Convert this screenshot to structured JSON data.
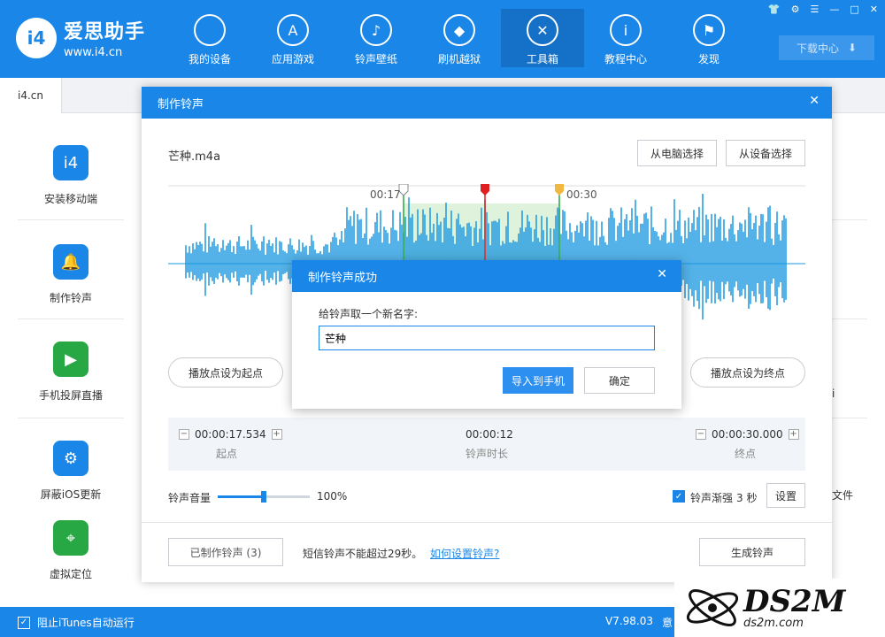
{
  "app": {
    "logo_text": "爱思助手",
    "logo_url": "www.i4.cn",
    "logo_badge": "i4",
    "brand_color": "#1a86e8"
  },
  "nav": {
    "items": [
      {
        "label": "我的设备",
        "icon": "apple-icon"
      },
      {
        "label": "应用游戏",
        "icon": "app-store-icon"
      },
      {
        "label": "铃声壁纸",
        "icon": "music-icon"
      },
      {
        "label": "刷机越狱",
        "icon": "box-icon"
      },
      {
        "label": "工具箱",
        "icon": "tools-icon"
      },
      {
        "label": "教程中心",
        "icon": "info-icon"
      },
      {
        "label": "发现",
        "icon": "flag-icon"
      }
    ],
    "active": "工具箱",
    "download_label": "下载中心"
  },
  "tabs": [
    {
      "label": "i4.cn"
    }
  ],
  "sidebar": {
    "items": [
      {
        "label": "安装移动端",
        "icon": "i4-app-icon",
        "color": "#1a86e8"
      },
      {
        "label": "制作铃声",
        "icon": "bell-icon",
        "color": "#1a86e8"
      },
      {
        "label": "手机投屏直播",
        "icon": "screen-cast-icon",
        "color": "#27a844"
      },
      {
        "label": "屏蔽iOS更新",
        "icon": "gear-icon",
        "color": "#1a86e8"
      },
      {
        "label": "虚拟定位",
        "icon": "location-icon",
        "color": "#27a844"
      }
    ]
  },
  "right_peek": {
    "text_a": "i",
    "text_b": "文件"
  },
  "ringtone_dialog": {
    "title": "制作铃声",
    "file_name": "芒种.m4a",
    "choose_pc": "从电脑选择",
    "choose_device": "从设备选择",
    "start_marker_time": "00:17",
    "end_marker_time": "00:30",
    "set_start_btn": "播放点设为起点",
    "set_end_btn": "播放点设为终点",
    "start_time": "00:00:17.534",
    "start_label": "起点",
    "duration_time": "00:00:12",
    "duration_label": "铃声时长",
    "end_time": "00:00:30.000",
    "end_label": "终点",
    "volume_label": "铃声音量",
    "volume_value": "100%",
    "volume_level": 0.5,
    "fade_checked": true,
    "fade_label": "铃声渐强",
    "fade_value": "3 秒",
    "settings_btn": "设置",
    "made_btn": "已制作铃声 (3)",
    "sms_note": "短信铃声不能超过29秒。",
    "howto_link": "如何设置铃声?",
    "generate_btn": "生成铃声"
  },
  "success_modal": {
    "title": "制作铃声成功",
    "prompt": "给铃声取一个新名字:",
    "name_value": "芒种",
    "import_btn": "导入到手机",
    "ok_btn": "确定"
  },
  "bottom_bar": {
    "itunes_label": "阻止iTunes自动运行",
    "version": "V7.98.03",
    "partial_text": "意"
  },
  "watermark": {
    "title": "DS2M",
    "url": "ds2m.com"
  }
}
